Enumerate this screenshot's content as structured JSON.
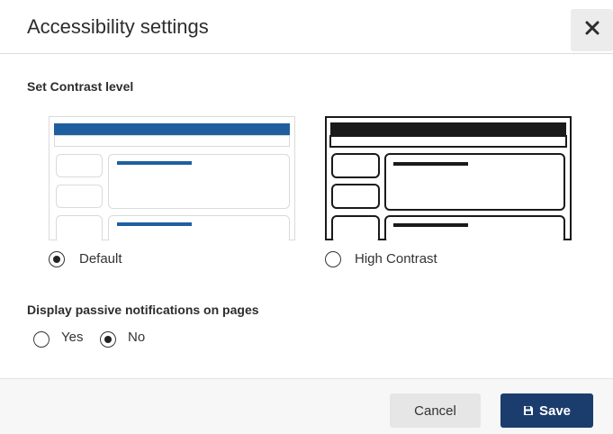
{
  "dialog": {
    "title": "Accessibility settings",
    "close_icon": "close-icon"
  },
  "contrast": {
    "label": "Set Contrast level",
    "options": [
      {
        "label": "Default",
        "selected": true
      },
      {
        "label": "High Contrast",
        "selected": false
      }
    ]
  },
  "notifications": {
    "label": "Display passive notifications on pages",
    "options": [
      {
        "label": "Yes",
        "selected": false
      },
      {
        "label": "No",
        "selected": true
      }
    ]
  },
  "footer": {
    "cancel_label": "Cancel",
    "save_label": "Save",
    "save_icon": "save-icon"
  },
  "colors": {
    "primary": "#1b3d6e",
    "preview_default_bar": "#1f5fa0",
    "high_contrast_bar": "#1a1a1a"
  }
}
